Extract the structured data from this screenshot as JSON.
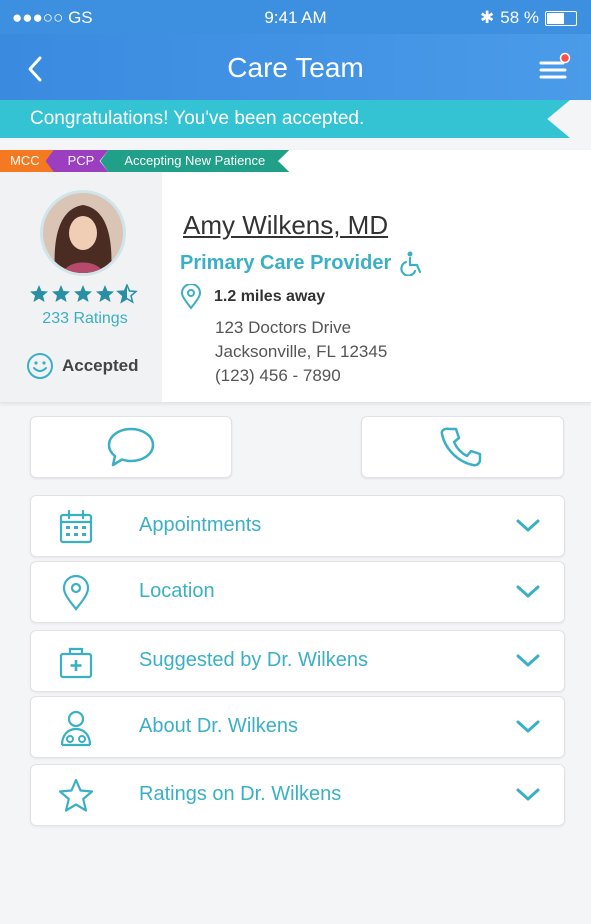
{
  "status_bar": {
    "carrier": "●●●○○ GS",
    "time": "9:41 AM",
    "battery": "58 %"
  },
  "nav": {
    "title": "Care Team"
  },
  "banner": {
    "text": "Congratulations! You've been accepted."
  },
  "tags": [
    {
      "label": "MCC",
      "color": "#f47920"
    },
    {
      "label": "PCP",
      "color": "#9b3ebf"
    },
    {
      "label": "Accepting New Patience",
      "color": "#20a088"
    }
  ],
  "doctor": {
    "name": "Amy Wilkens, MD",
    "role": "Primary Care Provider",
    "rating_stars": 4.5,
    "ratings_count": "233 Ratings",
    "status": "Accepted",
    "distance": "1.2 miles away",
    "address_line1": "123 Doctors Drive",
    "address_line2": "Jacksonville, FL 12345",
    "phone": "(123) 456 - 7890"
  },
  "actions": {
    "message_icon": "chat-bubble-icon",
    "call_icon": "phone-icon"
  },
  "sections": [
    {
      "label": "Appointments",
      "icon": "calendar-icon"
    },
    {
      "label": "Location",
      "icon": "location-pin-icon"
    },
    {
      "label": "Suggested by Dr. Wilkens",
      "icon": "medical-kit-icon"
    },
    {
      "label": "About Dr. Wilkens",
      "icon": "doctor-icon"
    },
    {
      "label": "Ratings on Dr. Wilkens",
      "icon": "star-icon"
    }
  ],
  "colors": {
    "accent": "#3bb0c5",
    "nav": "#3d8fe0",
    "banner": "#33c3d3"
  }
}
